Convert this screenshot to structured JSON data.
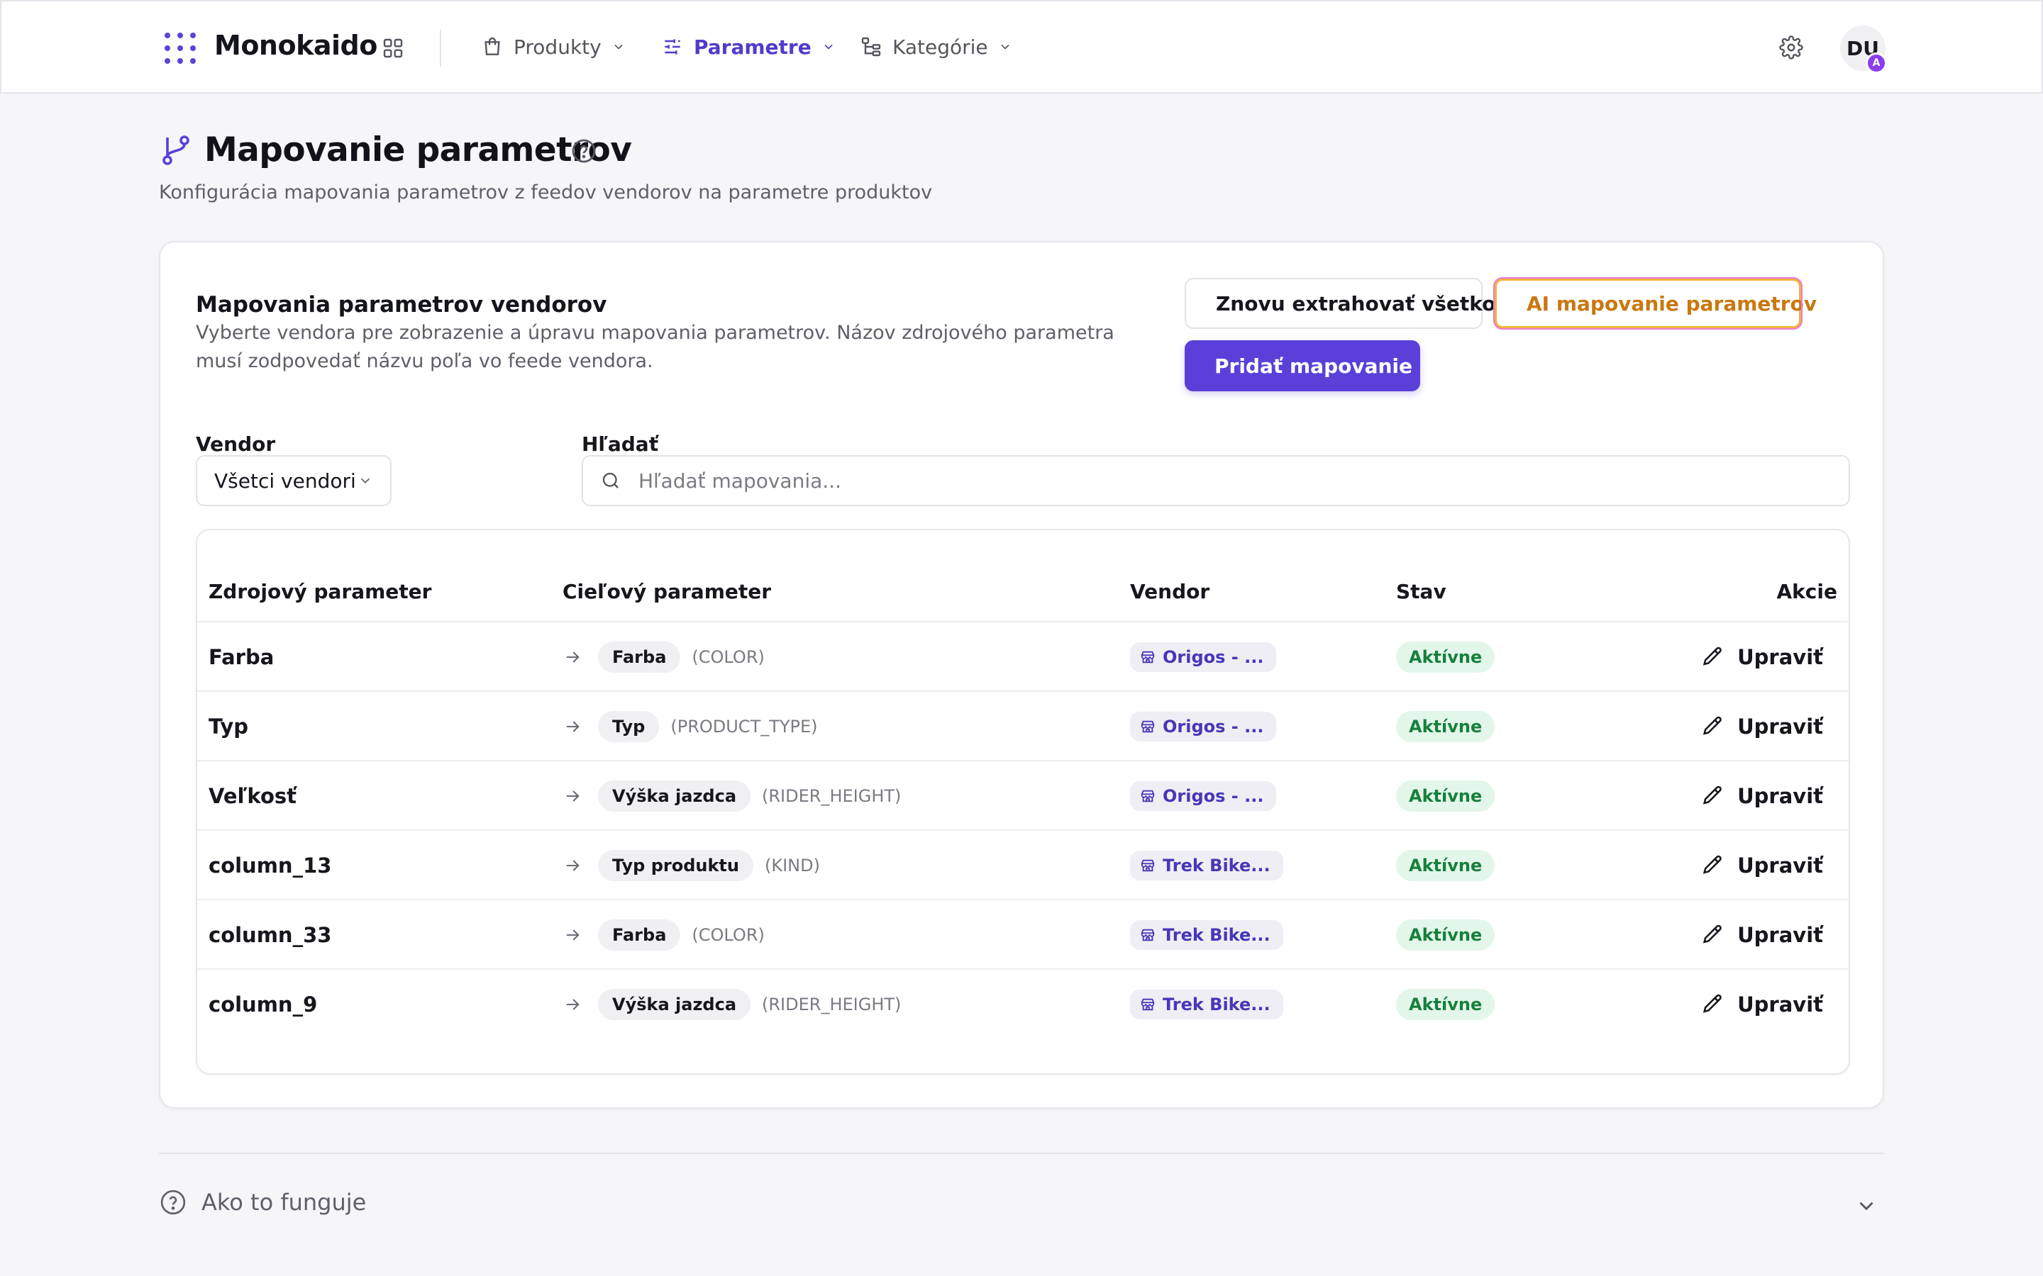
{
  "brand": {
    "name": "Monokaido"
  },
  "nav": {
    "items": [
      {
        "label": "Produkty"
      },
      {
        "label": "Parametre"
      },
      {
        "label": "Kategórie"
      }
    ]
  },
  "user": {
    "initials": "DU",
    "badge": "A"
  },
  "page": {
    "title": "Mapovanie parametrov",
    "subtitle": "Konfigurácia mapovania parametrov z feedov vendorov na parametre produktov"
  },
  "card": {
    "title": "Mapovania parametrov vendorov",
    "description": "Vyberte vendora pre zobrazenie a úpravu mapovania parametrov. Názov zdrojového parametra musí zodpovedať názvu poľa vo feede vendora.",
    "buttons": {
      "reextract": "Znovu extrahovať všetko",
      "ai": "AI mapovanie parametrov",
      "add": "Pridať mapovanie"
    },
    "filters": {
      "vendor_label": "Vendor",
      "vendor_value": "Všetci vendori",
      "search_label": "Hľadať",
      "search_placeholder": "Hľadať mapovania..."
    }
  },
  "table": {
    "headers": {
      "source": "Zdrojový parameter",
      "target": "Cieľový parameter",
      "vendor": "Vendor",
      "status": "Stav",
      "actions": "Akcie"
    },
    "rows": [
      {
        "source": "Farba",
        "target": "Farba",
        "code": "(COLOR)",
        "vendor": "Origos - ...",
        "status": "Aktívne",
        "action": "Upraviť"
      },
      {
        "source": "Typ",
        "target": "Typ",
        "code": "(PRODUCT_TYPE)",
        "vendor": "Origos - ...",
        "status": "Aktívne",
        "action": "Upraviť"
      },
      {
        "source": "Veľkosť",
        "target": "Výška jazdca",
        "code": "(RIDER_HEIGHT)",
        "vendor": "Origos - ...",
        "status": "Aktívne",
        "action": "Upraviť"
      },
      {
        "source": "column_13",
        "target": "Typ produktu",
        "code": "(KIND)",
        "vendor": "Trek Bike...",
        "status": "Aktívne",
        "action": "Upraviť"
      },
      {
        "source": "column_33",
        "target": "Farba",
        "code": "(COLOR)",
        "vendor": "Trek Bike...",
        "status": "Aktívne",
        "action": "Upraviť"
      },
      {
        "source": "column_9",
        "target": "Výška jazdca",
        "code": "(RIDER_HEIGHT)",
        "vendor": "Trek Bike...",
        "status": "Aktívne",
        "action": "Upraviť"
      }
    ]
  },
  "howto": {
    "label": "Ako to funguje"
  },
  "colors": {
    "accent": "#5a40d9",
    "ai_text": "#c97810",
    "status_bg": "#e3f6ea",
    "status_text": "#16803c",
    "vendor_text": "#4737b8"
  },
  "icons": {
    "logo": "dots-grid-icon",
    "apps": "apps-icon",
    "produkty": "shopping-bag-icon",
    "parametre": "sliders-icon",
    "kategorie": "tree-icon",
    "settings": "gear-icon",
    "page": "git-branch-icon",
    "help": "help-circle-icon",
    "reextract": "refresh-icon",
    "ai": "sparkle-dots-icon",
    "add": "plus-icon",
    "search": "search-icon",
    "arrow": "arrow-right-icon",
    "vendor": "store-icon",
    "edit": "pencil-icon"
  }
}
